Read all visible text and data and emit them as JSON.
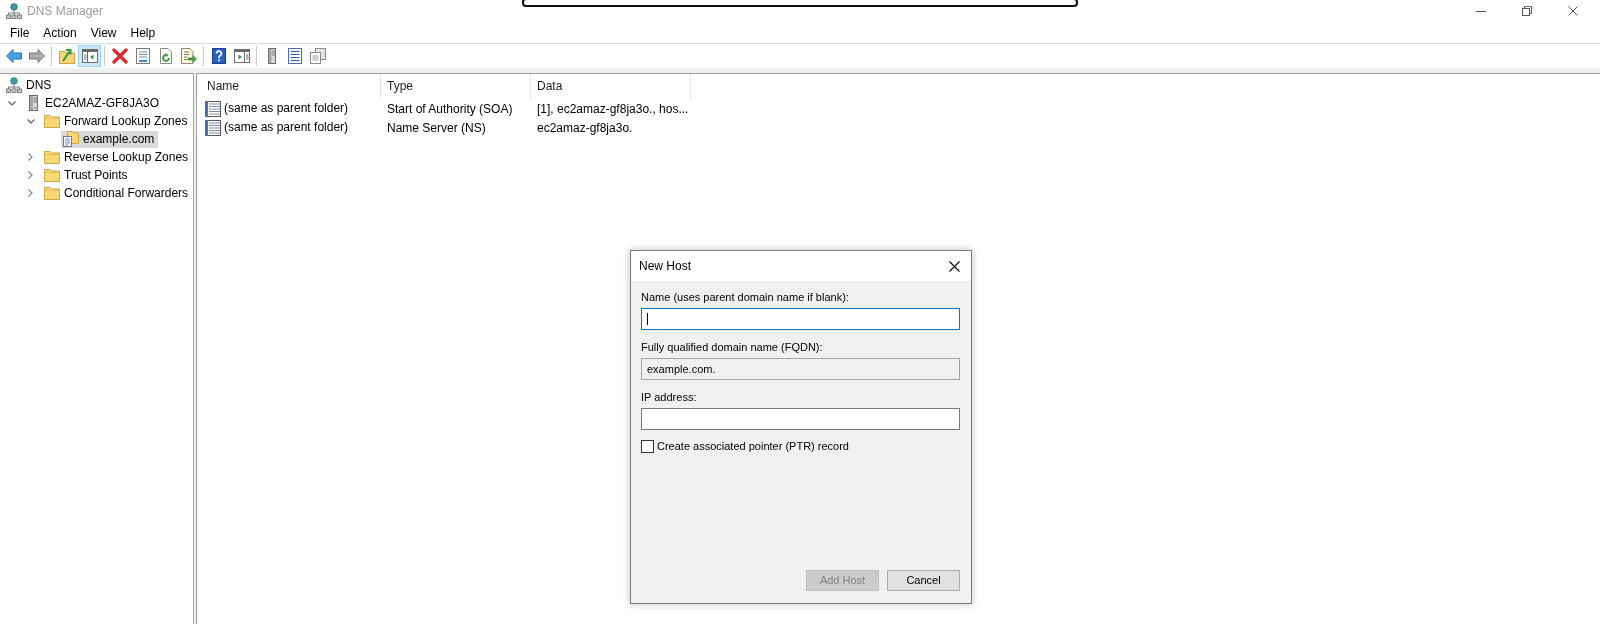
{
  "window": {
    "title": "DNS Manager",
    "active": false
  },
  "menu": [
    {
      "label": "File"
    },
    {
      "label": "Action"
    },
    {
      "label": "View"
    },
    {
      "label": "Help"
    }
  ],
  "toolbar": [
    {
      "kind": "button",
      "pressed": false,
      "disabled": false
    },
    {
      "kind": "button",
      "pressed": false,
      "disabled": true
    },
    {
      "kind": "separator"
    },
    {
      "kind": "button",
      "pressed": false,
      "disabled": false
    },
    {
      "kind": "button",
      "pressed": true,
      "disabled": false
    },
    {
      "kind": "separator"
    },
    {
      "kind": "button",
      "pressed": false,
      "disabled": false
    },
    {
      "kind": "button",
      "pressed": false,
      "disabled": false
    },
    {
      "kind": "button",
      "pressed": false,
      "disabled": false
    },
    {
      "kind": "button",
      "pressed": false,
      "disabled": false
    },
    {
      "kind": "separator"
    },
    {
      "kind": "button",
      "pressed": false,
      "disabled": false
    },
    {
      "kind": "button",
      "pressed": false,
      "disabled": false
    },
    {
      "kind": "separator"
    },
    {
      "kind": "button",
      "pressed": false,
      "disabled": false
    },
    {
      "kind": "button",
      "pressed": false,
      "disabled": false
    },
    {
      "kind": "button",
      "pressed": false,
      "disabled": false
    }
  ],
  "tree": [
    {
      "kind": "root",
      "label": "DNS",
      "selected": false,
      "children": [
        {
          "kind": "server",
          "label": "EC2AMAZ-GF8JA3O",
          "expanded": true,
          "selected": false,
          "children": [
            {
              "kind": "folder",
              "label": "Forward Lookup Zones",
              "expanded": true,
              "selected": false,
              "children": [
                {
                  "kind": "zone",
                  "label": "example.com",
                  "selected": true
                }
              ]
            },
            {
              "kind": "folder",
              "label": "Reverse Lookup Zones",
              "expanded": false,
              "selected": false
            },
            {
              "kind": "folder",
              "label": "Trust Points",
              "expanded": false,
              "selected": false
            },
            {
              "kind": "folder",
              "label": "Conditional Forwarders",
              "expanded": false,
              "selected": false
            }
          ]
        }
      ]
    }
  ],
  "records": {
    "columns": [
      "Name",
      "Type",
      "Data"
    ],
    "rows": [
      {
        "cells": [
          "(same as parent folder)",
          "Start of Authority (SOA)",
          "[1], ec2amaz-gf8ja3o., hos..."
        ],
        "selected": false
      },
      {
        "cells": [
          "(same as parent folder)",
          "Name Server (NS)",
          "ec2amaz-gf8ja3o."
        ],
        "selected": false
      }
    ]
  },
  "dialog": {
    "title": "New Host",
    "fields": [
      {
        "kind": "text",
        "label": "Name (uses parent domain name if blank):",
        "focused": true
      },
      {
        "kind": "readonly",
        "label": "Fully qualified domain name (FQDN):",
        "value": "example.com."
      },
      {
        "kind": "text",
        "label": "IP address:",
        "focused": false
      }
    ],
    "checkbox": {
      "label": "Create associated pointer (PTR) record",
      "checked": false
    },
    "buttons": [
      {
        "label": "Add Host",
        "disabled": true
      },
      {
        "label": "Cancel",
        "disabled": false
      }
    ]
  }
}
